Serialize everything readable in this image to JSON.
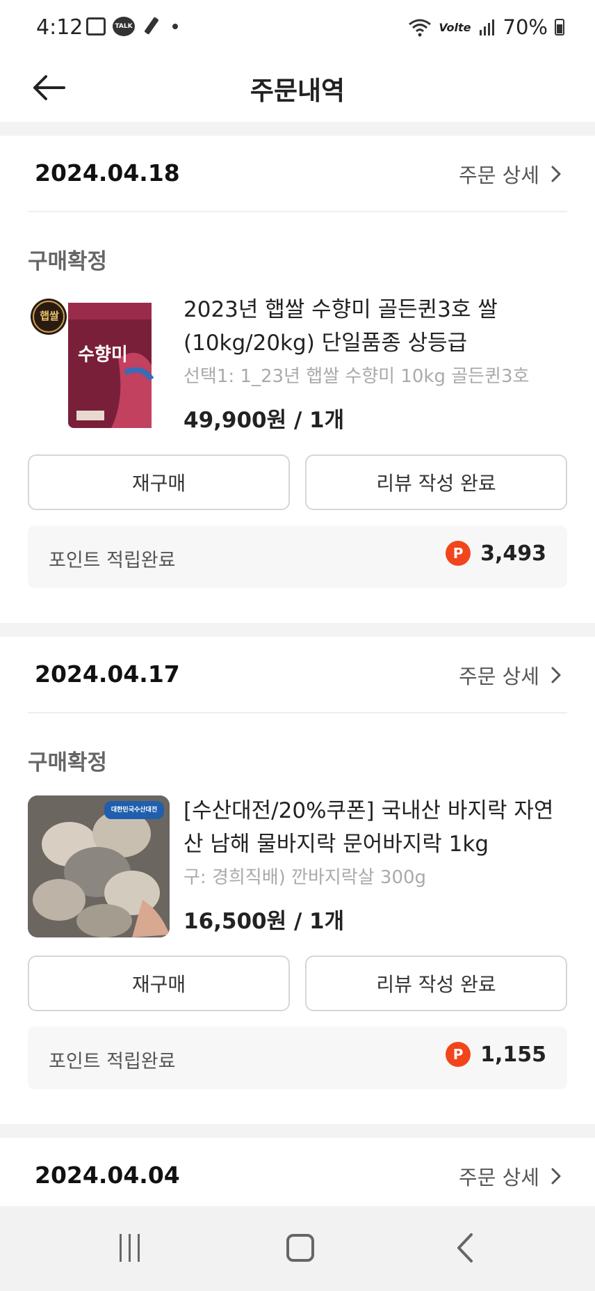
{
  "status_bar": {
    "time": "4:12",
    "talk_label": "TALK",
    "battery": "70%",
    "lte": "Volte"
  },
  "header": {
    "title": "주문내역"
  },
  "orders": [
    {
      "date": "2024.04.18",
      "detail_label": "주문 상세",
      "status": "구매확정",
      "product_name": "2023년 햅쌀 수향미 골든퀸3호 쌀 (10kg/20kg) 단일품종 상등급",
      "option": "선택1: 1_23년 햅쌀 수향미 10kg 골든퀸3호",
      "price": "49,900원 / 1개",
      "thumb_badge": "햅쌀",
      "thumb_text": "수향미",
      "rebuy_label": "재구매",
      "review_label": "리뷰 작성 완료",
      "points_label": "포인트 적립완료",
      "points_value": "3,493"
    },
    {
      "date": "2024.04.17",
      "detail_label": "주문 상세",
      "status": "구매확정",
      "product_name": "[수산대전/20%쿠폰] 국내산 바지락 자연산 남해 물바지락 문어바지락 1kg",
      "option": "구: 경희직배) 깐바지락살 300g",
      "price": "16,500원 / 1개",
      "thumb_text": "대한민국수산대전",
      "rebuy_label": "재구매",
      "review_label": "리뷰 작성 완료",
      "points_label": "포인트 적립완료",
      "points_value": "1,155"
    },
    {
      "date": "2024.04.04",
      "detail_label": "주문 상세"
    }
  ],
  "point_badge": "P",
  "colors": {
    "point_badge": "#f2451c",
    "divider": "#f3f3f3",
    "points_bg": "#f7f7f7"
  }
}
